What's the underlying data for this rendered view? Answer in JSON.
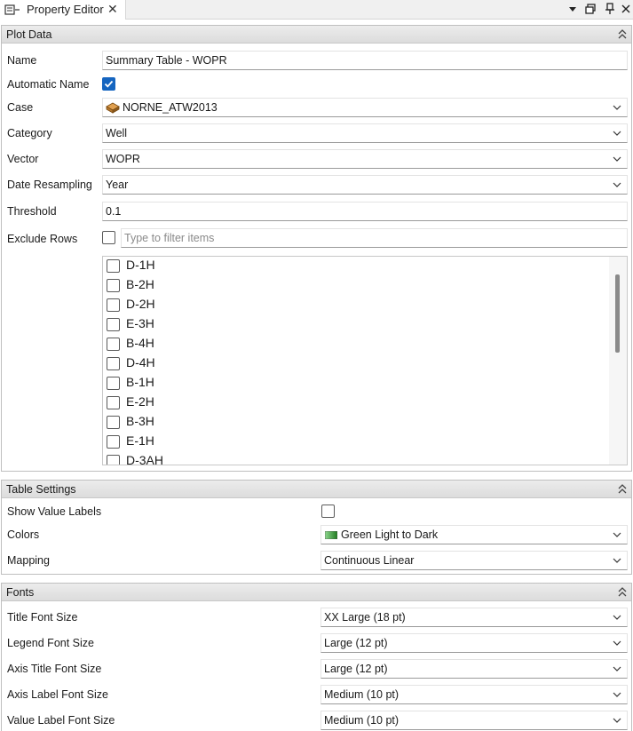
{
  "tab": {
    "title": "Property Editor",
    "close": "✕"
  },
  "plot_data": {
    "title": "Plot Data",
    "name_label": "Name",
    "name_value": "Summary Table - WOPR",
    "auto_name_label": "Automatic Name",
    "auto_name_checked": true,
    "case_label": "Case",
    "case_value": "NORNE_ATW2013",
    "category_label": "Category",
    "category_value": "Well",
    "vector_label": "Vector",
    "vector_value": "WOPR",
    "date_resampling_label": "Date Resampling",
    "date_resampling_value": "Year",
    "threshold_label": "Threshold",
    "threshold_value": "0.1",
    "exclude_rows_label": "Exclude Rows",
    "filter_placeholder": "Type to filter items",
    "rows": [
      "D-1H",
      "B-2H",
      "D-2H",
      "E-3H",
      "B-4H",
      "D-4H",
      "B-1H",
      "E-2H",
      "B-3H",
      "E-1H",
      "D-3AH"
    ]
  },
  "table_settings": {
    "title": "Table Settings",
    "show_value_labels_label": "Show Value Labels",
    "colors_label": "Colors",
    "colors_value": "Green Light to Dark",
    "mapping_label": "Mapping",
    "mapping_value": "Continuous Linear"
  },
  "fonts": {
    "title": "Fonts",
    "title_font_label": "Title Font Size",
    "title_font_value": "XX Large (18 pt)",
    "legend_font_label": "Legend Font Size",
    "legend_font_value": "Large (12 pt)",
    "axis_title_font_label": "Axis Title Font Size",
    "axis_title_font_value": "Large (12 pt)",
    "axis_label_font_label": "Axis Label Font Size",
    "axis_label_font_value": "Medium (10 pt)",
    "value_label_font_label": "Value Label Font Size",
    "value_label_font_value": "Medium (10 pt)"
  },
  "icons": {
    "tab": "property-editor-icon",
    "case": "case-icon",
    "colors": "color-gradient-icon",
    "float": "float-window-icon",
    "pin": "pin-icon",
    "menu": "dropdown-menu-icon"
  },
  "colors": {
    "accent": "#1565c0",
    "gradient_light": "#8fd88f",
    "gradient_dark": "#1f7a1f"
  }
}
